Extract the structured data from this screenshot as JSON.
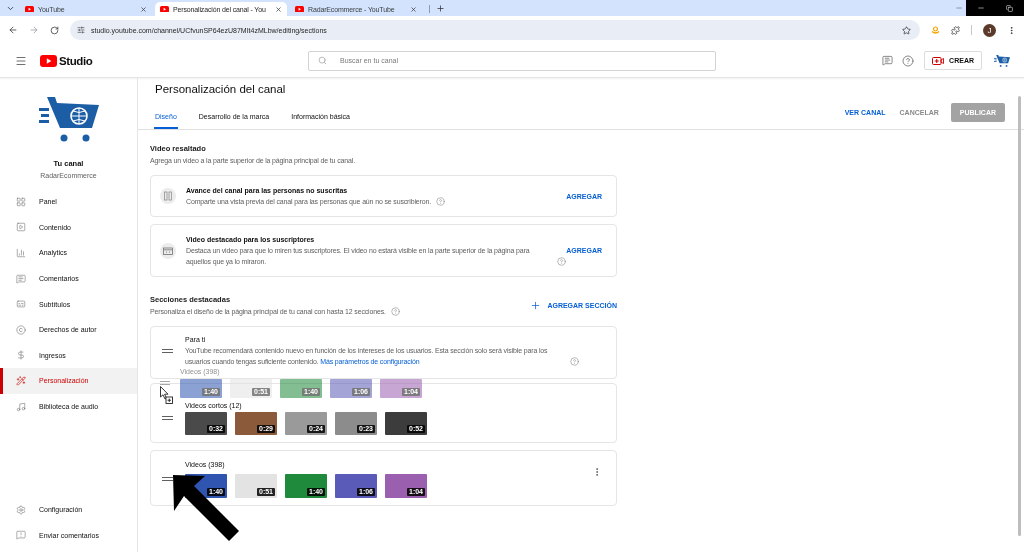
{
  "browser": {
    "tabs": [
      {
        "title": "YouTube",
        "selected": false
      },
      {
        "title": "Personalización del canal - You",
        "selected": true
      },
      {
        "title": "RadarEcommerce - YouTube",
        "selected": false
      }
    ],
    "url": "studio.youtube.com/channel/UCfvunSP64ezU87MIt4zMLbw/editing/sections",
    "profile_initial": "J"
  },
  "header": {
    "logo_text": "Studio",
    "search": {
      "placeholder": "Buscar en tu canal"
    },
    "create_button": "CREAR"
  },
  "sidebar": {
    "channel_title": "Tu canal",
    "channel_name": "RadarEcommerce",
    "items": [
      {
        "label": "Panel",
        "selected": false
      },
      {
        "label": "Contenido",
        "selected": false
      },
      {
        "label": "Analytics",
        "selected": false
      },
      {
        "label": "Comentarios",
        "selected": false
      },
      {
        "label": "Subtítulos",
        "selected": false
      },
      {
        "label": "Derechos de autor",
        "selected": false
      },
      {
        "label": "Ingresos",
        "selected": false
      },
      {
        "label": "Personalización",
        "selected": true
      },
      {
        "label": "Biblioteca de audio",
        "selected": false
      }
    ],
    "footer_items": [
      {
        "label": "Configuración"
      },
      {
        "label": "Enviar comentarios"
      }
    ]
  },
  "page": {
    "title": "Personalización del canal",
    "tabs": [
      {
        "label": "Diseño",
        "selected": true
      },
      {
        "label": "Desarrollo de la marca",
        "selected": false
      },
      {
        "label": "Información básica",
        "selected": false
      }
    ],
    "actions": [
      {
        "label": "VER CANAL",
        "kind": "text",
        "disabled": false
      },
      {
        "label": "CANCELAR",
        "kind": "text",
        "disabled": true
      },
      {
        "label": "PUBLICAR",
        "kind": "filled",
        "disabled": true
      }
    ]
  },
  "featured_video": {
    "title": "Video resaltado",
    "description": "Agrega un video a la parte superior de la página principal de tu canal.",
    "cards": [
      {
        "title": "Avance del canal para las personas no suscritas",
        "description": "Comparte una vista previa del canal para las personas que aún no se suscribieron.",
        "action": "AGREGAR"
      },
      {
        "title": "Video destacado para los suscriptores",
        "description": "Destaca un video para que lo miren tus suscriptores. El video no estará visible en la parte superior de la página para aquellos que ya lo miraron.",
        "action": "AGREGAR"
      }
    ]
  },
  "featured_sections": {
    "title": "Secciones destacadas",
    "description": "Personaliza el diseño de la página principal de tu canal con hasta 12 secciones.",
    "add_button": "AGREGAR SECCIÓN",
    "sections": [
      {
        "kind": "info",
        "title": "Para ti",
        "description": "YouTube recomendará contenido nuevo en función de los intereses de los usuarios. Esta sección solo será visible para los usuarios cuando tengas suficiente contenido.",
        "link": "Más parámetros de configuración"
      },
      {
        "kind": "videos",
        "title": "Videos cortos (12)",
        "show_menu": false,
        "thumbnails": [
          {
            "duration": "0:32"
          },
          {
            "duration": "0:29"
          },
          {
            "duration": "0:24"
          },
          {
            "duration": "0:23"
          },
          {
            "duration": "0:52"
          }
        ]
      },
      {
        "kind": "videos",
        "title": "Videos (398)",
        "show_menu": true,
        "thumbnails": [
          {
            "duration": "1:40"
          },
          {
            "duration": "0:51"
          },
          {
            "duration": "1:40"
          },
          {
            "duration": "1:06"
          },
          {
            "duration": "1:04"
          }
        ]
      }
    ],
    "drag_ghost": {
      "title": "Videos (398)",
      "thumbnails": [
        {
          "duration": "1:40"
        },
        {
          "duration": "0:51"
        },
        {
          "duration": "1:40"
        },
        {
          "duration": "1:06"
        },
        {
          "duration": "1:04"
        }
      ]
    }
  }
}
